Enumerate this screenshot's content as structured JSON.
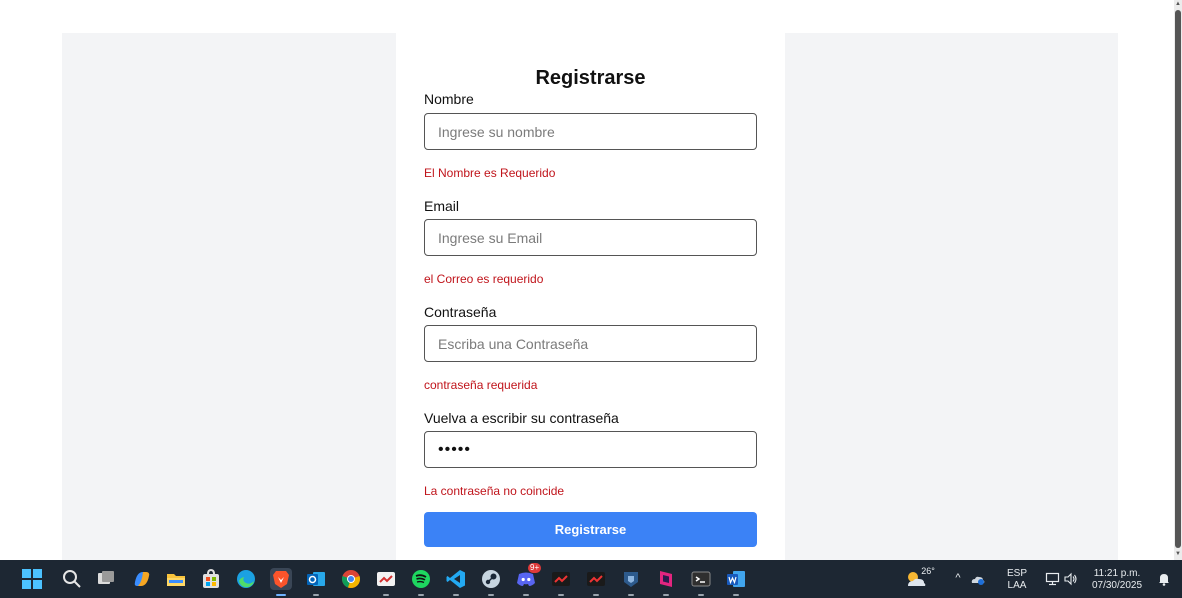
{
  "form": {
    "title": "Registrarse",
    "name_label": "Nombre",
    "name_placeholder": "Ingrese su nombre",
    "name_value": "",
    "name_error": "El Nombre es Requerido",
    "email_label": "Email",
    "email_placeholder": "Ingrese su Email",
    "email_value": "",
    "email_error": "el Correo es requerido",
    "password_label": "Contraseña",
    "password_placeholder": "Escriba una Contraseña",
    "password_value": "",
    "password_error": "contraseña requerida",
    "confirm_label": "Vuelva a escribir su contraseña",
    "confirm_value": "•••••",
    "confirm_error": "La contraseña no coincide",
    "submit_label": "Registrarse"
  },
  "colors": {
    "accent": "#3b82f6",
    "error": "#c0141b",
    "page_bg": "#f3f4f6",
    "taskbar_bg": "#1d2733"
  },
  "taskbar": {
    "apps": [
      "windows-start-icon",
      "search-icon",
      "task-view-icon",
      "copilot-icon",
      "file-explorer-icon",
      "microsoft-store-icon",
      "edge-icon",
      "brave-icon",
      "outlook-icon",
      "chrome-icon",
      "app-icon",
      "spotify-icon",
      "vscode-icon",
      "steam-icon",
      "discord-icon",
      "app-icon",
      "app-icon",
      "app-icon",
      "app-icon",
      "terminal-icon",
      "word-icon"
    ],
    "discord_badge": "9+",
    "weather_temp": "26°",
    "language_top": "ESP",
    "language_bottom": "LAA",
    "time": "11:21 p.m.",
    "date": "07/30/2025"
  }
}
